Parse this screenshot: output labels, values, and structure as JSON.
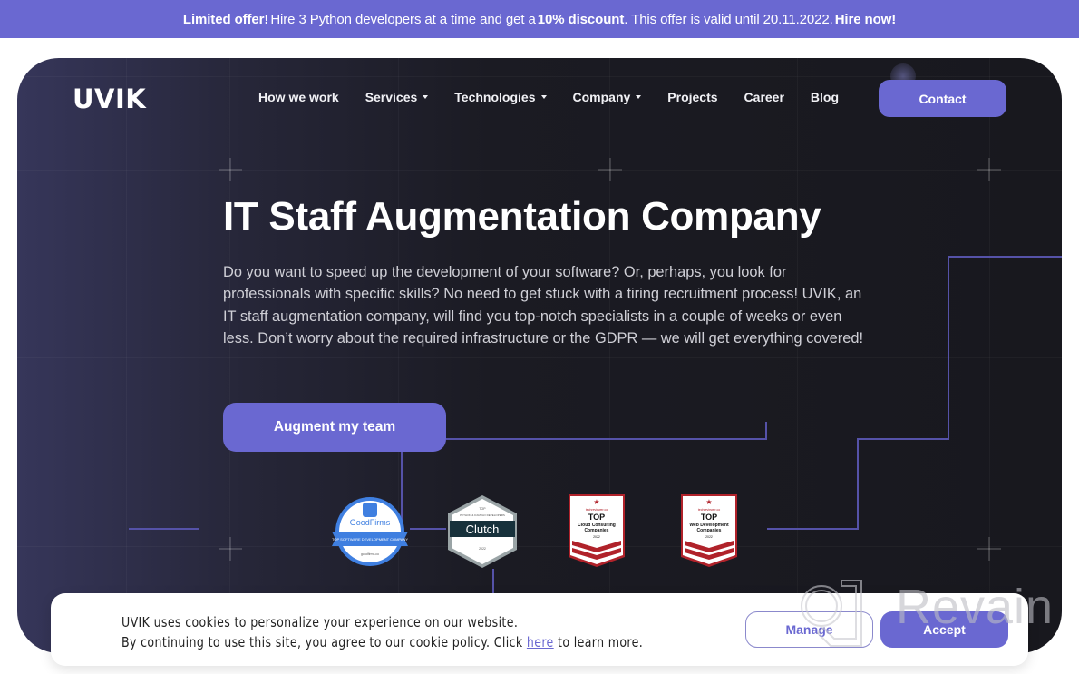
{
  "promo": {
    "lead": "Limited offer!",
    "text1": "Hire 3 Python developers at a time and get a",
    "discount": "10% discount",
    "text2": ". This offer is valid until 20.11.2022.",
    "cta": "Hire now!"
  },
  "header": {
    "logo": "UVIK",
    "nav": [
      {
        "label": "How we work",
        "dropdown": false
      },
      {
        "label": "Services",
        "dropdown": true
      },
      {
        "label": "Technologies",
        "dropdown": true
      },
      {
        "label": "Company",
        "dropdown": true
      },
      {
        "label": "Projects",
        "dropdown": false
      },
      {
        "label": "Career",
        "dropdown": false
      },
      {
        "label": "Blog",
        "dropdown": false
      }
    ],
    "contact_label": "Contact"
  },
  "hero": {
    "title": "IT Staff Augmentation Company",
    "description": "Do you want to speed up the development of your software? Or, perhaps, you look for professionals with specific skills? No need to get stuck with a tiring recruitment process! UVIK, an IT staff augmentation company, will find you top-notch specialists in a couple of weeks or even less. Don’t worry about the required infrastructure or the GDPR — we will get everything covered!",
    "cta_label": "Augment my team"
  },
  "badges": {
    "goodfirms": {
      "brand": "GoodFirms",
      "ribbon": "TOP SOFTWARE DEVELOPMENT COMPANY",
      "site": "goodfirms.co"
    },
    "clutch": {
      "top": "TOP",
      "category": "PYTHON & DJANGO DEVELOPERS",
      "brand": "Clutch",
      "year": "2022"
    },
    "techreviewer1": {
      "site": "techreviewer.co",
      "top": "TOP",
      "line1": "Cloud Consulting",
      "line2": "Companies",
      "year": "2022"
    },
    "techreviewer2": {
      "site": "techreviewer.co",
      "top": "TOP",
      "line1": "Web Development",
      "line2": "Companies",
      "year": "2022"
    }
  },
  "cookie": {
    "line1": "UVIK uses cookies to personalize your experience on our website.",
    "line2_before": "By continuing to use this site, you agree to our cookie policy. Click ",
    "link": "here",
    "line2_after": " to learn more.",
    "manage_label": "Manage",
    "accept_label": "Accept"
  },
  "watermark": {
    "text": "Revain"
  },
  "colors": {
    "accent": "#6a68d1",
    "hero_bg": "#18181e",
    "badge_red": "#b0222a",
    "goodfirms_blue": "#3f7fe0",
    "clutch_dark": "#17313b"
  }
}
